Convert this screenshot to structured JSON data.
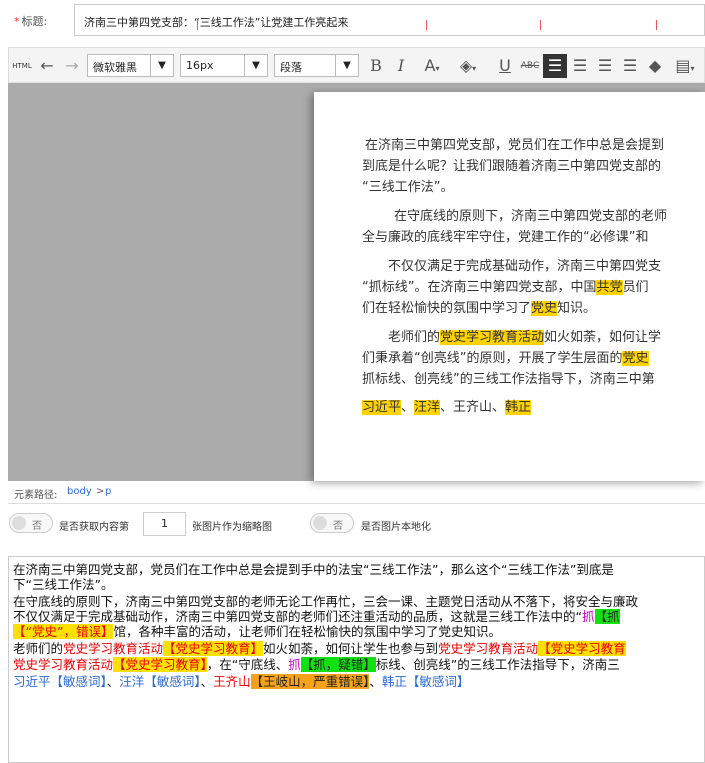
{
  "title_field": {
    "label": "标题:",
    "required_mark": "*",
    "value": "济南三中第四党支部：“三线工作法”让党建工作亮起来"
  },
  "toolbar": {
    "html_label": "HTML",
    "font_family": "微软雅黑",
    "font_size": "16px",
    "paragraph": "段落",
    "icons": [
      "html-icon",
      "undo-icon",
      "redo-icon",
      "bold-icon",
      "italic-icon",
      "font-color-icon",
      "background-color-icon",
      "underline-icon",
      "strikethrough-icon",
      "align-left-icon",
      "align-center-icon",
      "align-right-icon",
      "justify-icon",
      "eraser-icon",
      "table-icon"
    ]
  },
  "editor": {
    "p1": [
      "在济南三中第四党支部，党员们在工作中总是会提到",
      "到底是什么呢？让我们跟随着济南三中第四党支部的",
      "“三线工作法”。"
    ],
    "p2": [
      "在守底线的原则下，济南三中第四党支部的老师",
      "全与廉政的底线牢牢守住，党建工作的“必修课”和"
    ],
    "p3a": "不仅仅满足于完成基础动作，济南三中第四党支",
    "p3b_pre": "“抓标线”。在济南三中第四党支部，中国",
    "p3b_hl": "共党",
    "p3b_post": "员们",
    "p3c_pre": "们在轻松愉快的氛围中学习了",
    "p3c_hl": "党史",
    "p3c_post": "知识。",
    "p4a_pre": "老师们的",
    "p4a_hl": "党史学习教育活动",
    "p4a_post": "如火如荼，如何让学",
    "p4b_pre": "们秉承着“创亮线”的原则，开展了学生层面的",
    "p4b_hl": "党史",
    "p4c": "抓标线、创亮线”的三线工作法指导下，济南三中第",
    "names": [
      "习近平",
      "、",
      "汪洋",
      "、王齐山、",
      "韩正"
    ]
  },
  "path_bar": {
    "label": "元素路径:",
    "body": "body",
    "sep": ">",
    "p": "p"
  },
  "options": {
    "toggle_off": "否",
    "fetch_label": "是否获取内容第",
    "fetch_count": "1",
    "fetch_suffix": "张图片作为缩略图",
    "localize_label": "是否图片本地化"
  },
  "result": {
    "l1": "在济南三中第四党支部，党员们在工作中总是会提到手中的法宝“三线工作法”，那么这个“三线工作法”到底是",
    "l2": "下“三线工作法”。",
    "l3": "在守底线的原则下，济南三中第四党支部的老师无论工作再忙，三会一课、主题党日活动从不落下，将安全与廉政",
    "l4a": "不仅仅满足于完成基础动作，济南三中第四党支部的老师们还注重活动的品质，这就是三线工作法中的“",
    "l4b": "抓",
    "l4c": "【抓",
    "l5a": "【“党史”，错误】",
    "l5b": "馆，各种丰富的活动，让老师们在轻松愉快的氛围中学习了党史知识。",
    "l6a": "老师们的",
    "l6b": "党史学习教育活动",
    "l6c": "【党史学习教育】",
    "l6d": "如火如荼，如何让学生也参与到",
    "l6e": "党史学习教育活动",
    "l6f": "【党史学习教育",
    "l7a": "党史学习教育活动",
    "l7b": "【党史学习教育】",
    "l7c": "，在“守底线、",
    "l7d": "抓",
    "l7e": "【抓，疑错】",
    "l7f": "标线、创亮线”的三线工作法指导下，济南三",
    "l8a": "习近平",
    "l8b": "【敏感词】",
    "l8c": "、",
    "l8d": "汪洋",
    "l8e": "【敏感词】",
    "l8f": "、",
    "l8g": "王齐山",
    "l8h": "【王岐山，严重错误】",
    "l8i": "、",
    "l8j": "韩正",
    "l8k": "【敏感词】"
  }
}
